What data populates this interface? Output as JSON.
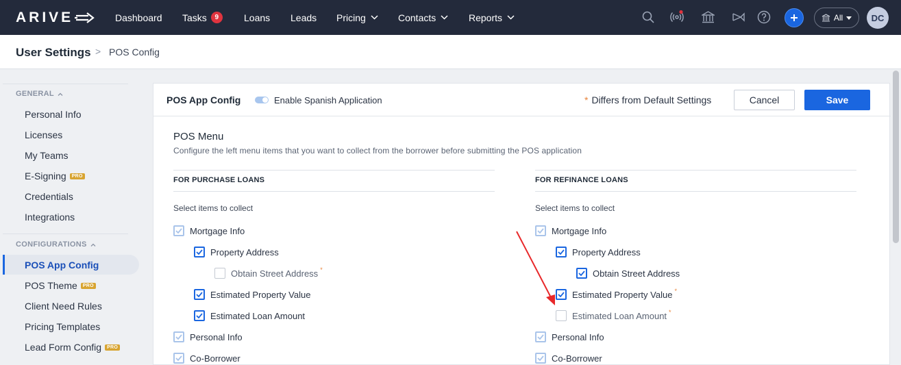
{
  "nav": {
    "logo": "ARIVE",
    "items": [
      {
        "label": "Dashboard"
      },
      {
        "label": "Tasks",
        "badge": "9"
      },
      {
        "label": "Loans"
      },
      {
        "label": "Leads"
      },
      {
        "label": "Pricing"
      },
      {
        "label": "Contacts"
      },
      {
        "label": "Reports"
      }
    ],
    "icons": [
      "search-icon",
      "broadcast-icon",
      "bank-icon",
      "megaphone-icon",
      "help-icon",
      "plus-icon"
    ],
    "scope_select": "All",
    "user_initials": "DC"
  },
  "breadcrumb": {
    "title": "User Settings",
    "separator": ">",
    "current": "POS Config"
  },
  "sidebar": {
    "general_heading": "GENERAL",
    "general_items": [
      {
        "label": "Personal Info"
      },
      {
        "label": "Licenses"
      },
      {
        "label": "My Teams"
      },
      {
        "label": "E-Signing",
        "pro": "PRO"
      },
      {
        "label": "Credentials"
      },
      {
        "label": "Integrations"
      }
    ],
    "config_heading": "CONFIGURATIONS",
    "config_items": [
      {
        "label": "POS App Config",
        "active": true
      },
      {
        "label": "POS Theme",
        "pro": "PRO"
      },
      {
        "label": "Client Need Rules"
      },
      {
        "label": "Pricing Templates"
      },
      {
        "label": "Lead Form Config",
        "pro": "PRO"
      }
    ]
  },
  "panel": {
    "title": "POS App Config",
    "toggle_label": "Enable Spanish Application",
    "toggle_on": true,
    "differs_asterisk": "*",
    "differs_text": "Differs from Default Settings",
    "cancel_label": "Cancel",
    "save_label": "Save",
    "section_title": "POS Menu",
    "section_desc": "Configure the left menu items that you want to collect from the borrower before submitting the POS application"
  },
  "purchase": {
    "heading": "FOR PURCHASE LOANS",
    "subheading": "Select items to collect",
    "items": [
      {
        "label": "Mortgage Info",
        "state": "locked",
        "level": 0
      },
      {
        "label": "Property Address",
        "state": "checked",
        "level": 1
      },
      {
        "label": "Obtain Street Address",
        "state": "empty",
        "level": 2,
        "required": "*"
      },
      {
        "label": "Estimated Property Value",
        "state": "checked",
        "level": 1
      },
      {
        "label": "Estimated Loan Amount",
        "state": "checked",
        "level": 1
      },
      {
        "label": "Personal Info",
        "state": "locked",
        "level": 0
      },
      {
        "label": "Co-Borrower",
        "state": "locked",
        "level": 0
      }
    ]
  },
  "refinance": {
    "heading": "FOR REFINANCE LOANS",
    "subheading": "Select items to collect",
    "items": [
      {
        "label": "Mortgage Info",
        "state": "locked",
        "level": 0
      },
      {
        "label": "Property Address",
        "state": "checked",
        "level": 1
      },
      {
        "label": "Obtain Street Address",
        "state": "checked",
        "level": 2
      },
      {
        "label": "Estimated Property Value",
        "state": "checked",
        "level": 1,
        "required": "*"
      },
      {
        "label": "Estimated Loan Amount",
        "state": "empty",
        "level": 1,
        "required": "*"
      },
      {
        "label": "Personal Info",
        "state": "locked",
        "level": 0
      },
      {
        "label": "Co-Borrower",
        "state": "locked",
        "level": 0
      }
    ]
  },
  "colors": {
    "nav_bg": "#232a3b",
    "accent": "#1a66e0",
    "required": "#e8833a",
    "annotation_arrow": "#e8282a"
  }
}
